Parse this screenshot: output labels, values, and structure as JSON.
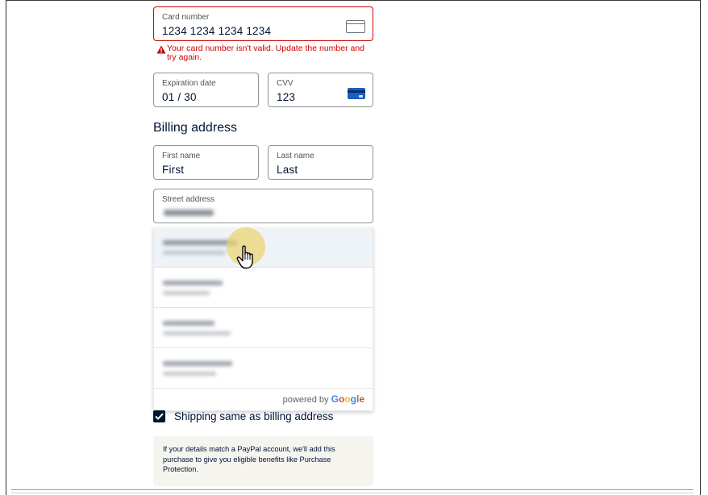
{
  "card": {
    "number_label": "Card number",
    "number_value": "1234 1234 1234 1234",
    "error_message": "Your card number isn't valid. Update the number and try again.",
    "card_icon": "generic-card-icon",
    "expiry_label": "Expiration date",
    "expiry_value": "01 / 30",
    "cvv_label": "CVV",
    "cvv_value": "123",
    "cvv_icon": "cvv-card-icon",
    "error_color": "#d20000"
  },
  "billing": {
    "title": "Billing address",
    "first_name_label": "First name",
    "first_name_value": "First",
    "last_name_label": "Last name",
    "last_name_value": "Last",
    "street_label": "Street address"
  },
  "autocomplete": {
    "suggestion_count": 4,
    "powered_by_prefix": "powered by",
    "google_letters": [
      "G",
      "o",
      "o",
      "g",
      "l",
      "e"
    ],
    "google_colors": [
      "#4285F4",
      "#EA4335",
      "#FBBC05",
      "#4285F4",
      "#34A853",
      "#EA4335"
    ]
  },
  "shipping": {
    "checked": true,
    "label": "Shipping same as billing address"
  },
  "notice": {
    "text": "If your details match a PayPal account, we'll add this purchase to give you eligible benefits like Purchase Protection."
  },
  "colors": {
    "text_primary": "#001435",
    "checkbox_fill": "#001435",
    "highlight_row": "#eef3f8",
    "notice_bg": "#f5f4ef",
    "cursor_halo": "#ebd26e"
  }
}
